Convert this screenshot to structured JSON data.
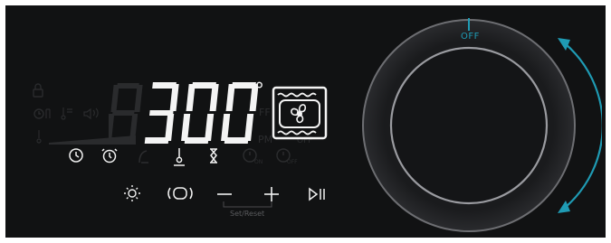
{
  "display": {
    "temperature": "300",
    "degree_symbol": "°",
    "ghost_digit": "8",
    "ghost_texts": {
      "off": "FF",
      "pm": "PM",
      "f": "F",
      "on": "ON",
      "off_small": "OFF"
    }
  },
  "function_icons": [
    {
      "name": "clock-icon",
      "active": true
    },
    {
      "name": "alarm-clock-icon",
      "active": true
    },
    {
      "name": "probe-icon",
      "active": false
    },
    {
      "name": "thermometer-icon",
      "active": true
    },
    {
      "name": "hourglass-icon",
      "active": true
    },
    {
      "name": "timer-on-icon",
      "active": false
    },
    {
      "name": "timer-off-icon",
      "active": false
    }
  ],
  "controls": {
    "light": "light",
    "fan": "fan",
    "minus": "—",
    "plus": "+",
    "start_pause": "start/pause",
    "set_reset_label": "Set/Reset"
  },
  "knob": {
    "off_label": "OFF",
    "accent_color": "#1f9bb4"
  },
  "colors": {
    "panel": "#111213",
    "lit": "#f2f2f2",
    "ghost": "#2a2b2d",
    "accent": "#1f9bb4"
  }
}
